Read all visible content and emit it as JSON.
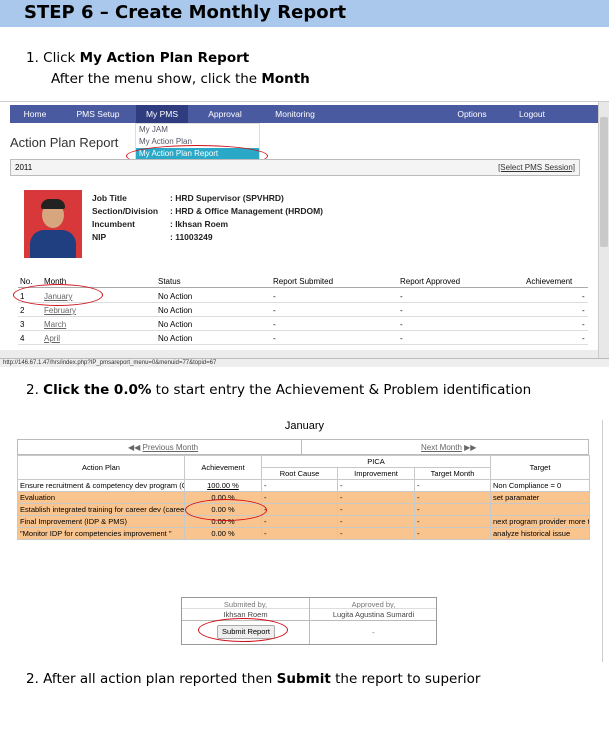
{
  "header": {
    "title": "STEP 6 – Create Monthly Report"
  },
  "instructions": {
    "step1_pre": "1.   Click ",
    "step1_bold": "My Action Plan Report",
    "step1_line2_pre": "After the menu show, click the ",
    "step1_line2_bold": "Month",
    "step2_pre": "2. ",
    "step2_bold": "Click the 0.0%",
    "step2_post": " to start entry the Achievement & Problem identification",
    "step3_pre": "2.   After all action plan reported then ",
    "step3_bold": "Submit",
    "step3_post": " the report to superior"
  },
  "screenshot1": {
    "nav": [
      "Home",
      "PMS Setup",
      "My PMS",
      "Approval",
      "Monitoring",
      "Options",
      "Logout"
    ],
    "dropdown": [
      "My JAM",
      "My Action Plan",
      "My Action Plan Report"
    ],
    "page_title": "Action Plan Report",
    "session_year": "2011",
    "session_link": "[Select PMS Session]",
    "profile": {
      "labels": [
        "Job Title",
        "Section/Division",
        "Incumbent",
        "NIP"
      ],
      "values": [
        ": HRD Supervisor (SPVHRD)",
        ": HRD & Office Management (HRDOM)",
        ": Ikhsan Roem",
        ": 11003249"
      ]
    },
    "columns": [
      "No.",
      "Month",
      "Status",
      "Report Submited",
      "Report Approved",
      "Achievement"
    ],
    "rows": [
      {
        "no": "1",
        "month": "January",
        "status": "No Action",
        "submitted": "-",
        "approved": "-",
        "achievement": "-"
      },
      {
        "no": "2",
        "month": "February",
        "status": "No Action",
        "submitted": "-",
        "approved": "-",
        "achievement": "-"
      },
      {
        "no": "3",
        "month": "March",
        "status": "No Action",
        "submitted": "-",
        "approved": "-",
        "achievement": "-"
      },
      {
        "no": "4",
        "month": "April",
        "status": "No Action",
        "submitted": "-",
        "approved": "-",
        "achievement": "-"
      }
    ],
    "status_url": "http://146.67.1.47/hrs/index.php?IP_pmsareport_menu=0&menuid=77&topid=67"
  },
  "screenshot2": {
    "month": "January",
    "prev": "Previous Month",
    "next": "Next Month",
    "headers": {
      "action_plan": "Action Plan",
      "achievement": "Achievement",
      "pica": "PICA",
      "root_cause": "Root Cause",
      "improvement": "Improvement",
      "target_month": "Target Month",
      "target": "Target"
    },
    "rows": [
      {
        "plan": "Ensure recruitment & competency dev program (C",
        "achievement": "100.00 %",
        "root": "-",
        "impr": "-",
        "tmonth": "-",
        "target": "Non Compliance = 0",
        "highlight": false
      },
      {
        "plan": "Evaluation",
        "achievement": "0.00 %",
        "root": "-",
        "impr": "-",
        "tmonth": "-",
        "target": "set paramater",
        "highlight": true
      },
      {
        "plan": "Establish integrated training for career dev (career",
        "achievement": "0.00 %",
        "root": "-",
        "impr": "-",
        "tmonth": "-",
        "target": "",
        "highlight": true
      },
      {
        "plan": "Final Improvement (IDP & PMS)",
        "achievement": "0.00 %",
        "root": "-",
        "impr": "-",
        "tmonth": "-",
        "target": "next program provider more t",
        "highlight": true
      },
      {
        "plan": "\"Monitor IDP for competencies improvement \"",
        "achievement": "0.00 %",
        "root": "-",
        "impr": "-",
        "tmonth": "-",
        "target": "analyze historical issue",
        "highlight": true
      }
    ],
    "submit": {
      "submitted_by": "Submited by,",
      "submitter": "Ikhsan Roem",
      "approved_by": "Approved by,",
      "approver": "Lugita Agustina Sumardi",
      "button": "Submit Report",
      "approved_value": "-"
    }
  },
  "colors": {
    "header_bg": "#a9c8ec",
    "nav_bg": "#4a5aa0",
    "highlight_row": "#f9c48e",
    "annotation": "#d0101a"
  }
}
